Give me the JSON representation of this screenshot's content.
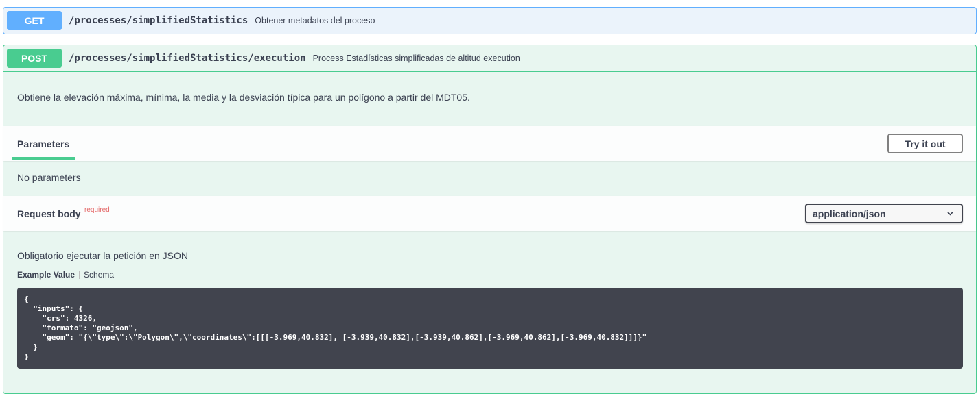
{
  "get_op": {
    "method": "GET",
    "path": "/processes/simplifiedStatistics",
    "summary": "Obtener metadatos del proceso"
  },
  "post_op": {
    "method": "POST",
    "path": "/processes/simplifiedStatistics/execution",
    "summary": "Process Estadísticas simplificadas de altitud execution",
    "description": "Obtiene la elevación máxima, mínima, la media y la desviación típica para un polígono a partir del MDT05.",
    "parameters_tab": "Parameters",
    "try_it_out": "Try it out",
    "no_parameters": "No parameters",
    "request_body_title": "Request body",
    "required_label": "required",
    "content_type": "application/json",
    "request_body_description": "Obligatorio ejecutar la petición en JSON",
    "example_tab": "Example Value",
    "schema_tab": "Schema",
    "example_lines": [
      "{",
      "  \"inputs\": {",
      "    \"crs\": 4326,",
      "    \"formato\": \"geojson\",",
      "    \"geom\": \"{\\\"type\\\":\\\"Polygon\\\",\\\"coordinates\\\":[[[-3.969,40.832], [-3.939,40.832],[-3.939,40.862],[-3.969,40.862],[-3.969,40.832]]]}\"",
      "  }",
      "}"
    ]
  },
  "colors": {
    "get": "#61affe",
    "post": "#49cc90",
    "code_bg": "#41444e",
    "required": "#e46a6a"
  }
}
